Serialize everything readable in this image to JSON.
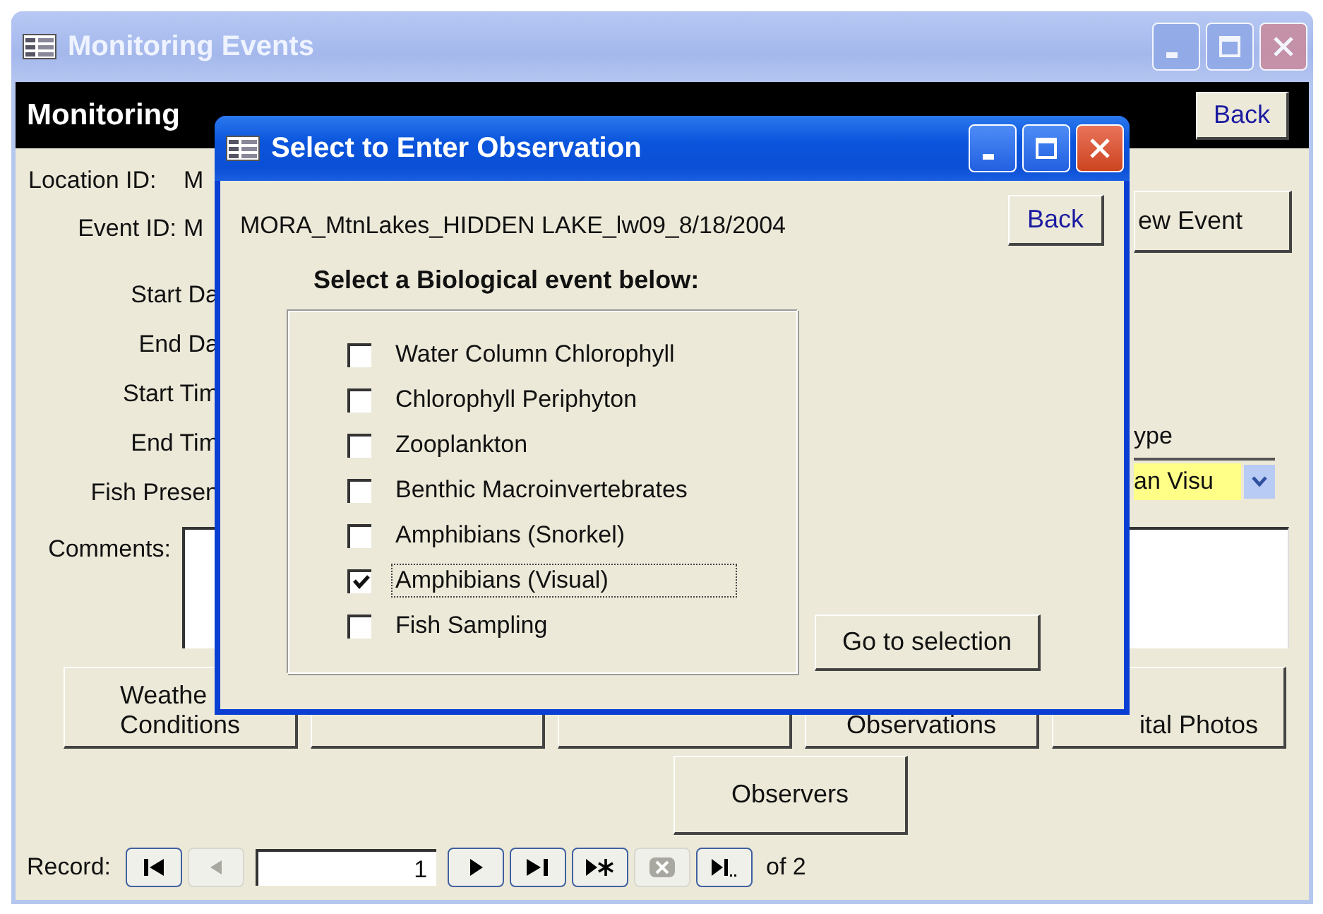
{
  "window": {
    "title": "Monitoring Events"
  },
  "header": {
    "title": "Monitoring",
    "back_button": "Back"
  },
  "fields": [
    {
      "kind": "value",
      "label": "Location ID:",
      "value": "M"
    },
    {
      "kind": "value",
      "label": "Event ID:",
      "value": "M"
    },
    {
      "kind": "label",
      "label": "Start Da"
    },
    {
      "kind": "label",
      "label": "End Da"
    },
    {
      "kind": "label",
      "label": "Start Tim"
    },
    {
      "kind": "label",
      "label": "End Tim"
    },
    {
      "kind": "label",
      "label": "Fish Presen"
    }
  ],
  "new_event_button": "ew Event",
  "type_label": "ype",
  "type_combo": {
    "value": "an Visu"
  },
  "comments": {
    "label": "Comments:"
  },
  "buttons": [
    {
      "kind": "text",
      "lines": [
        "Weathe",
        "Conditions"
      ]
    },
    {
      "kind": "covered"
    },
    {
      "kind": "covered"
    },
    {
      "kind": "text",
      "lines": [
        "Observations"
      ]
    },
    {
      "kind": "text",
      "lines": [
        "ital Photos"
      ]
    }
  ],
  "observers_button": "Observers",
  "record_nav": {
    "label": "Record:",
    "current": "1",
    "of_label": "of 2",
    "buttons": [
      {
        "kind": "first",
        "disabled": false
      },
      {
        "kind": "prev",
        "disabled": true
      },
      {
        "kind": "field"
      },
      {
        "kind": "next",
        "disabled": false
      },
      {
        "kind": "last",
        "disabled": false
      },
      {
        "kind": "new",
        "disabled": false
      },
      {
        "kind": "delete",
        "disabled": true
      },
      {
        "kind": "more",
        "disabled": false
      }
    ]
  },
  "dialog": {
    "title": "Select to Enter Observation",
    "event_name": "MORA_MtnLakes_HIDDEN LAKE_lw09_8/18/2004",
    "back_button": "Back",
    "prompt": "Select a Biological event below:",
    "options": [
      {
        "label": "Water Column Chlorophyll",
        "checked": false,
        "focused": false
      },
      {
        "label": "Chlorophyll Periphyton",
        "checked": false,
        "focused": false
      },
      {
        "label": "Zooplankton",
        "checked": false,
        "focused": false
      },
      {
        "label": "Benthic Macroinvertebrates",
        "checked": false,
        "focused": false
      },
      {
        "label": "Amphibians (Snorkel)",
        "checked": false,
        "focused": false
      },
      {
        "label": "Amphibians (Visual)",
        "checked": true,
        "focused": true
      },
      {
        "label": "Fish Sampling",
        "checked": false,
        "focused": false
      }
    ],
    "go_button": "Go to selection"
  }
}
